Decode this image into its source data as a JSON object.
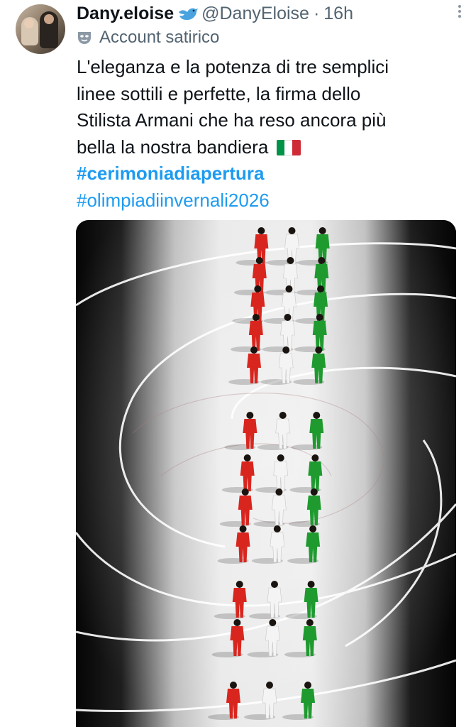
{
  "tweet": {
    "author": {
      "display_name": "Dany.eloise",
      "verified_icon": "bird-icon",
      "handle": "@DanyEloise",
      "separator": "·",
      "time": "16h"
    },
    "account_label": "Account satirico",
    "label_icon": "mask-icon",
    "text_lines": [
      "L'eleganza e la potenza di tre semplici",
      "linee sottili e perfette, la firma dello",
      "Stilista Armani che ha reso ancora più",
      "bella la nostra bandiera"
    ],
    "flag_emoji": "italian-flag-icon",
    "hashtags": [
      "#cerimoniadiapertura",
      "#olimpiadiinvernali2026"
    ],
    "media": {
      "description_icon": "photo",
      "rows": 11
    },
    "colors": {
      "link": "#1d9bf0",
      "secondary": "#536471",
      "flag_green": "#009246",
      "flag_white": "#ffffff",
      "flag_red": "#ce2b37",
      "figure_red": "#d8261f",
      "figure_white": "#f4f4f4",
      "figure_green": "#1f9a2f"
    }
  }
}
